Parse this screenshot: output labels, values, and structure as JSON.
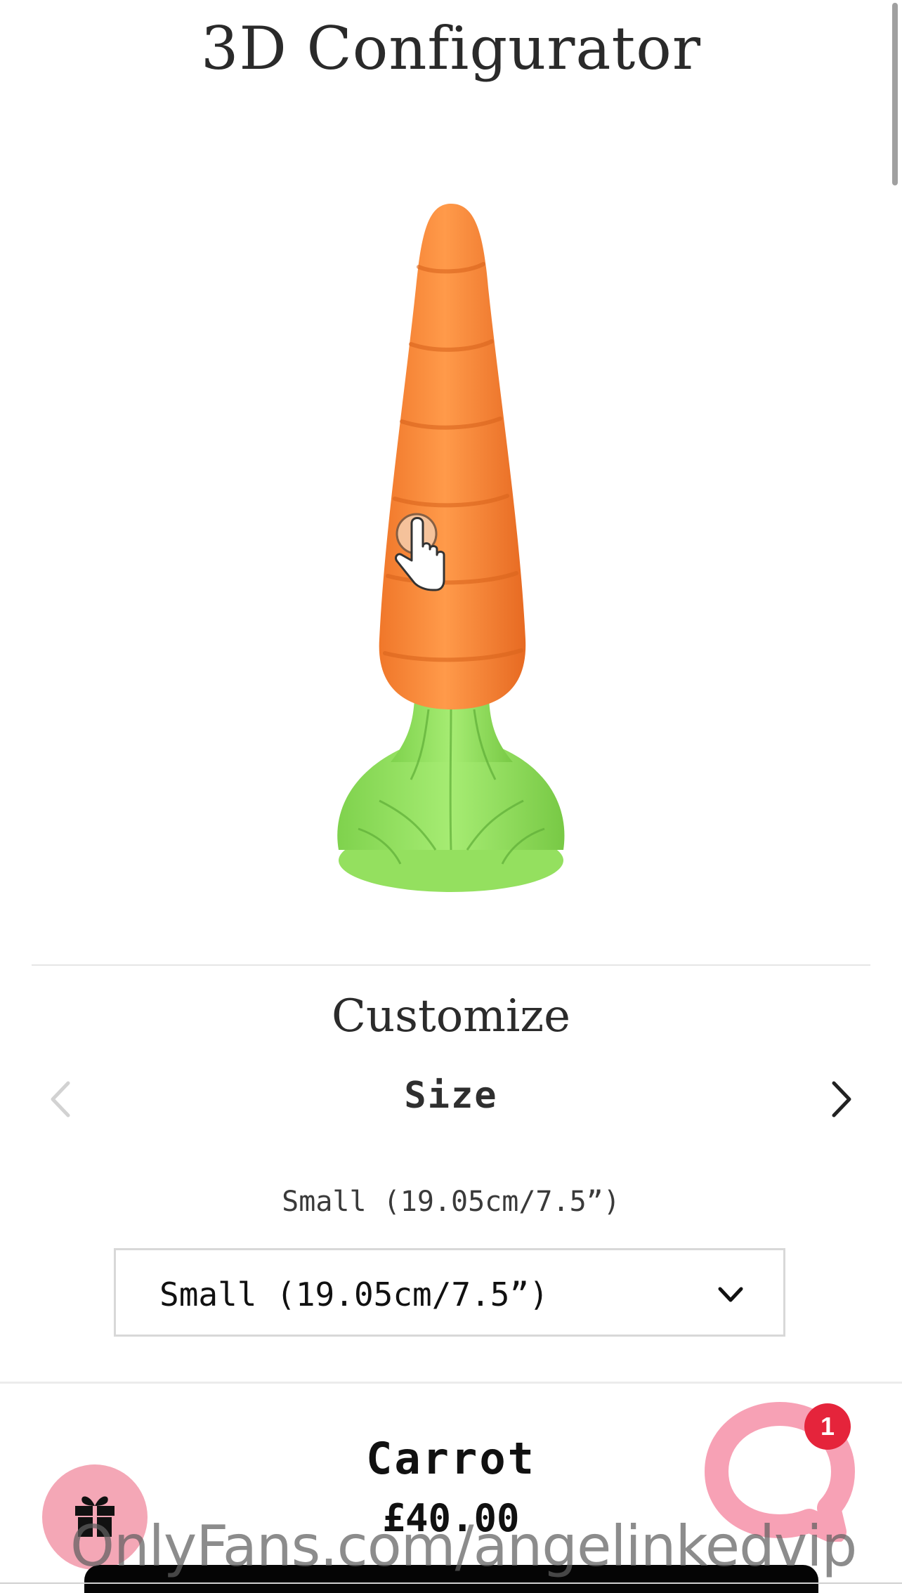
{
  "header": {
    "title": "3D Configurator"
  },
  "viewer": {
    "model": "carrot",
    "interaction_hint_icon": "touch-hand-icon"
  },
  "customize": {
    "title": "Customize",
    "option_name": "Size",
    "prev_icon": "chevron-left-icon",
    "next_icon": "chevron-right-icon",
    "selected_label": "Small (19.05cm/7.5”)",
    "select_value": "Small (19.05cm/7.5”)"
  },
  "product": {
    "name": "Carrot",
    "price": "£40.00"
  },
  "floating": {
    "gift_icon": "gift-icon",
    "chat_icon": "chat-bubble-icon",
    "chat_badge": "1"
  },
  "watermark": {
    "text": "OnlyFans.com/angelinkedvip"
  },
  "colors": {
    "carrot": "#f2802f",
    "leaves": "#8fdc5a",
    "gift_button": "#f4a7b6",
    "badge": "#e5243b",
    "chat_bubble": "#f7a1b5"
  }
}
